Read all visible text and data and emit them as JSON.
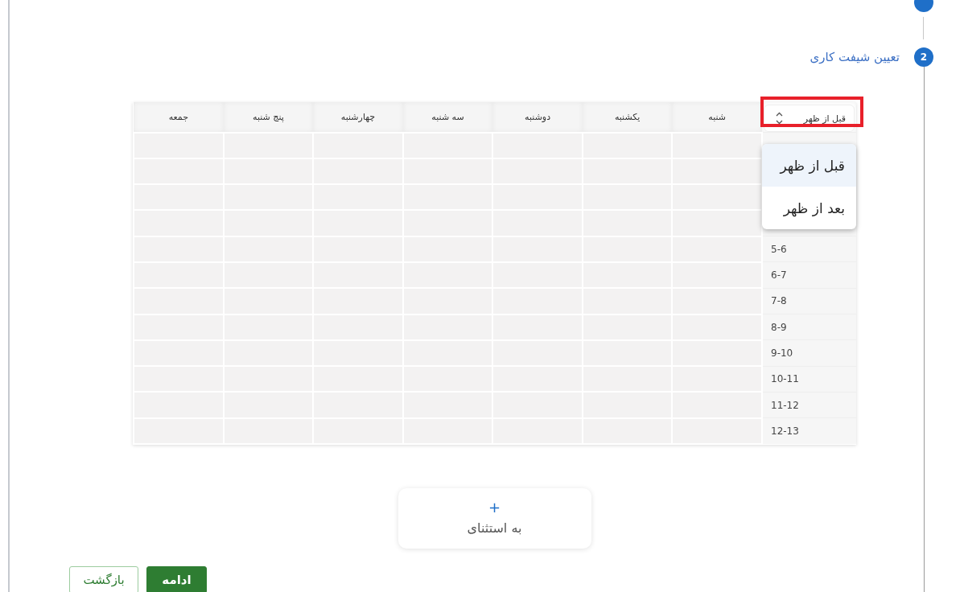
{
  "stepper": {
    "steps": [
      {
        "kind": "cut"
      },
      {
        "kind": "full",
        "number": "2",
        "title": "تعیین شیفت کاری",
        "active": true
      }
    ]
  },
  "schedule": {
    "period_select": {
      "value": "قبل از ظهر",
      "highlighted": true
    },
    "period_menu": [
      {
        "label": "قبل از ظهر",
        "selected": true
      },
      {
        "label": "بعد از ظهر",
        "selected": false
      }
    ],
    "days": [
      "شنبه",
      "یکشنبه",
      "دوشنبه",
      "سه شنبه",
      "چهارشنبه",
      "پنج شنبه",
      "جمعه"
    ],
    "rows": [
      {},
      {},
      {},
      {},
      {
        "time": "5-6"
      },
      {
        "time": "6-7"
      },
      {
        "time": "7-8"
      },
      {
        "time": "8-9"
      },
      {
        "time": "9-10"
      },
      {
        "time": "10-11"
      },
      {
        "time": "11-12"
      },
      {
        "time": "12-13"
      }
    ]
  },
  "exception_card": {
    "icon": "+",
    "label": "به استثنای"
  },
  "buttons": [
    {
      "label": "ادامه",
      "kind": "primary"
    },
    {
      "label": "بازگشت",
      "kind": "secondary"
    }
  ]
}
